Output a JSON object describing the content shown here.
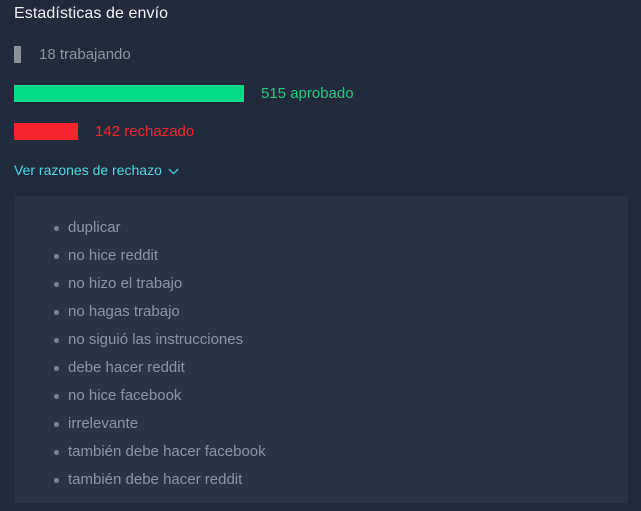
{
  "widget": {
    "title": "Estadísticas de envío"
  },
  "stats": [
    {
      "key": "working",
      "label": "18 trabajando",
      "count": 18,
      "bar_color": "#8a9199",
      "text_color": "#8c959f"
    },
    {
      "key": "approved",
      "label": "515 aprobado",
      "count": 515,
      "bar_color": "#00dc83",
      "text_color": "#24c97c"
    },
    {
      "key": "rejected",
      "label": "142 rechazado",
      "count": 142,
      "bar_color": "#f7252f",
      "text_color": "#f6252f"
    }
  ],
  "toggle": {
    "label": "Ver razones de rechazo",
    "icon": "chevron-down-icon",
    "color": "#4dd6e0",
    "expanded": true
  },
  "reasons": [
    "duplicar",
    "no hice reddit",
    "no hizo el trabajo",
    "no hagas trabajo",
    "no siguió las instrucciones",
    "debe hacer reddit",
    "no hice facebook",
    "irrelevante",
    "también debe hacer facebook",
    "también debe hacer reddit"
  ],
  "colors": {
    "background": "#222b3c",
    "panel": "#2a3447",
    "title_text": "#f2f4f7",
    "list_text": "#8b95a1",
    "bullet": "#7b8593"
  }
}
